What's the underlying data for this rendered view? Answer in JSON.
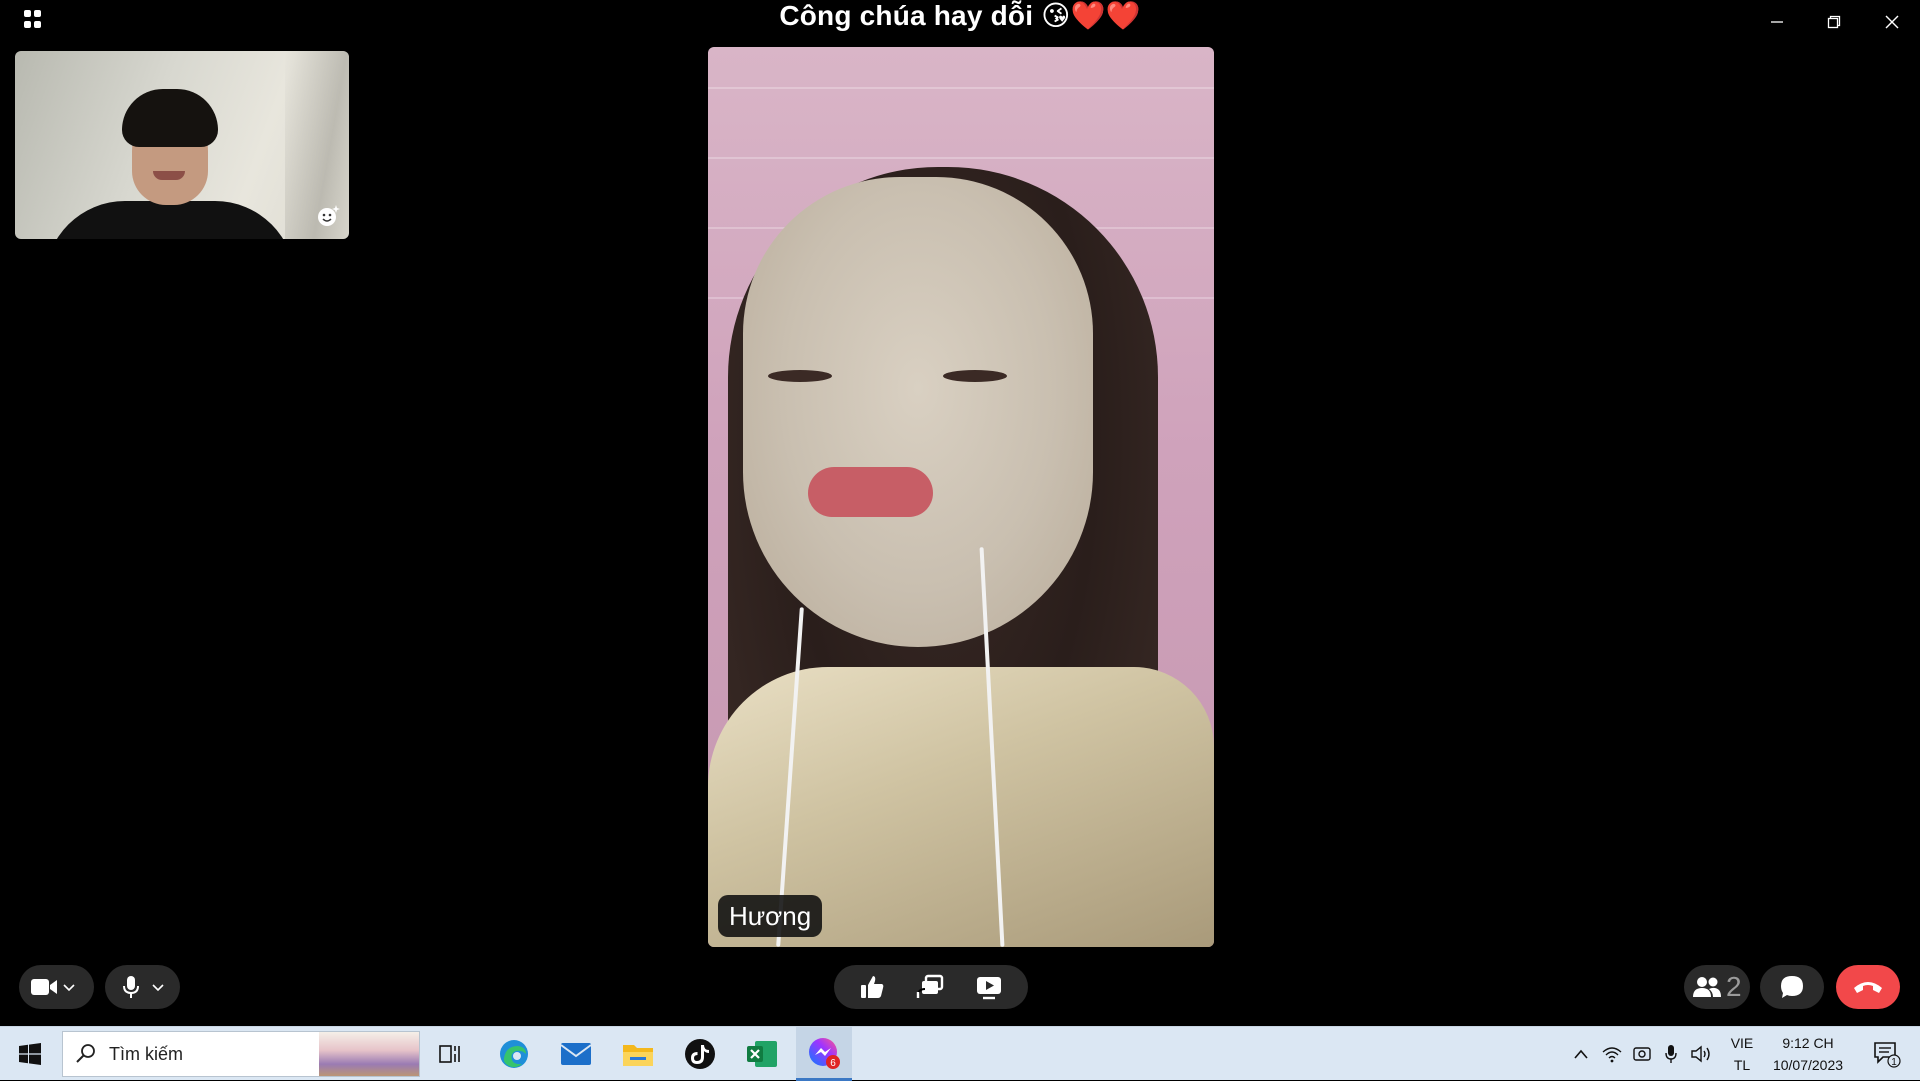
{
  "window": {
    "title": "Công chúa hay dỗi 😘❤️❤️"
  },
  "remote": {
    "name": "Hương"
  },
  "controls": {
    "participants_count": "2"
  },
  "taskbar": {
    "search_placeholder": "Tìm kiếm",
    "apps": [
      "task-view",
      "edge",
      "mail",
      "file-explorer",
      "tiktok",
      "excel",
      "messenger"
    ],
    "messenger_badge": "6",
    "language_top": "VIE",
    "language_bottom": "TL",
    "time": "9:12 CH",
    "date": "10/07/2023",
    "notification_count": "1"
  },
  "colors": {
    "background": "#000000",
    "control_pill": "#2a2a2a",
    "end_call": "#f2484a",
    "taskbar": "#dbe7f3"
  }
}
